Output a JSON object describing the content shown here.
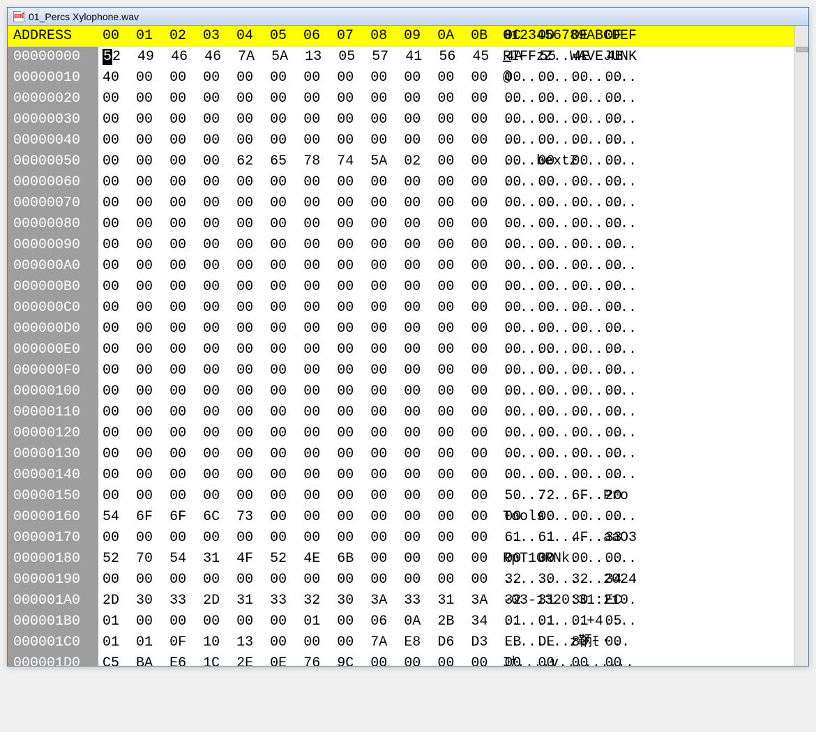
{
  "window": {
    "title": "01_Percs Xylophone.wav",
    "icon_label": "BIN"
  },
  "header": {
    "address_label": "ADDRESS",
    "hex_cols": [
      "00",
      "01",
      "02",
      "03",
      "04",
      "05",
      "06",
      "07",
      "08",
      "09",
      "0A",
      "0B",
      "0C",
      "0D",
      "0E",
      "0F"
    ],
    "ascii_label": "0123456789ABCDEF"
  },
  "cursor": {
    "row": 0,
    "col": 0
  },
  "rows": [
    {
      "addr": "00000000",
      "hex": [
        "52",
        "49",
        "46",
        "46",
        "7A",
        "5A",
        "13",
        "05",
        "57",
        "41",
        "56",
        "45",
        "4A",
        "55",
        "4E",
        "4B"
      ],
      "ascii": "RIFFzZ..WAVEJUNK"
    },
    {
      "addr": "00000010",
      "hex": [
        "40",
        "00",
        "00",
        "00",
        "00",
        "00",
        "00",
        "00",
        "00",
        "00",
        "00",
        "00",
        "00",
        "00",
        "00",
        "00"
      ],
      "ascii": "@..............."
    },
    {
      "addr": "00000020",
      "hex": [
        "00",
        "00",
        "00",
        "00",
        "00",
        "00",
        "00",
        "00",
        "00",
        "00",
        "00",
        "00",
        "00",
        "00",
        "00",
        "00"
      ],
      "ascii": "................"
    },
    {
      "addr": "00000030",
      "hex": [
        "00",
        "00",
        "00",
        "00",
        "00",
        "00",
        "00",
        "00",
        "00",
        "00",
        "00",
        "00",
        "00",
        "00",
        "00",
        "00"
      ],
      "ascii": "................"
    },
    {
      "addr": "00000040",
      "hex": [
        "00",
        "00",
        "00",
        "00",
        "00",
        "00",
        "00",
        "00",
        "00",
        "00",
        "00",
        "00",
        "00",
        "00",
        "00",
        "00"
      ],
      "ascii": "................"
    },
    {
      "addr": "00000050",
      "hex": [
        "00",
        "00",
        "00",
        "00",
        "62",
        "65",
        "78",
        "74",
        "5A",
        "02",
        "00",
        "00",
        "00",
        "00",
        "00",
        "00"
      ],
      "ascii": "....bextZ......."
    },
    {
      "addr": "00000060",
      "hex": [
        "00",
        "00",
        "00",
        "00",
        "00",
        "00",
        "00",
        "00",
        "00",
        "00",
        "00",
        "00",
        "00",
        "00",
        "00",
        "00"
      ],
      "ascii": "................"
    },
    {
      "addr": "00000070",
      "hex": [
        "00",
        "00",
        "00",
        "00",
        "00",
        "00",
        "00",
        "00",
        "00",
        "00",
        "00",
        "00",
        "00",
        "00",
        "00",
        "00"
      ],
      "ascii": "................"
    },
    {
      "addr": "00000080",
      "hex": [
        "00",
        "00",
        "00",
        "00",
        "00",
        "00",
        "00",
        "00",
        "00",
        "00",
        "00",
        "00",
        "00",
        "00",
        "00",
        "00"
      ],
      "ascii": "................"
    },
    {
      "addr": "00000090",
      "hex": [
        "00",
        "00",
        "00",
        "00",
        "00",
        "00",
        "00",
        "00",
        "00",
        "00",
        "00",
        "00",
        "00",
        "00",
        "00",
        "00"
      ],
      "ascii": "................"
    },
    {
      "addr": "000000A0",
      "hex": [
        "00",
        "00",
        "00",
        "00",
        "00",
        "00",
        "00",
        "00",
        "00",
        "00",
        "00",
        "00",
        "00",
        "00",
        "00",
        "00"
      ],
      "ascii": "................"
    },
    {
      "addr": "000000B0",
      "hex": [
        "00",
        "00",
        "00",
        "00",
        "00",
        "00",
        "00",
        "00",
        "00",
        "00",
        "00",
        "00",
        "00",
        "00",
        "00",
        "00"
      ],
      "ascii": "................"
    },
    {
      "addr": "000000C0",
      "hex": [
        "00",
        "00",
        "00",
        "00",
        "00",
        "00",
        "00",
        "00",
        "00",
        "00",
        "00",
        "00",
        "00",
        "00",
        "00",
        "00"
      ],
      "ascii": "................"
    },
    {
      "addr": "000000D0",
      "hex": [
        "00",
        "00",
        "00",
        "00",
        "00",
        "00",
        "00",
        "00",
        "00",
        "00",
        "00",
        "00",
        "00",
        "00",
        "00",
        "00"
      ],
      "ascii": "................"
    },
    {
      "addr": "000000E0",
      "hex": [
        "00",
        "00",
        "00",
        "00",
        "00",
        "00",
        "00",
        "00",
        "00",
        "00",
        "00",
        "00",
        "00",
        "00",
        "00",
        "00"
      ],
      "ascii": "................"
    },
    {
      "addr": "000000F0",
      "hex": [
        "00",
        "00",
        "00",
        "00",
        "00",
        "00",
        "00",
        "00",
        "00",
        "00",
        "00",
        "00",
        "00",
        "00",
        "00",
        "00"
      ],
      "ascii": "................"
    },
    {
      "addr": "00000100",
      "hex": [
        "00",
        "00",
        "00",
        "00",
        "00",
        "00",
        "00",
        "00",
        "00",
        "00",
        "00",
        "00",
        "00",
        "00",
        "00",
        "00"
      ],
      "ascii": "................"
    },
    {
      "addr": "00000110",
      "hex": [
        "00",
        "00",
        "00",
        "00",
        "00",
        "00",
        "00",
        "00",
        "00",
        "00",
        "00",
        "00",
        "00",
        "00",
        "00",
        "00"
      ],
      "ascii": "................"
    },
    {
      "addr": "00000120",
      "hex": [
        "00",
        "00",
        "00",
        "00",
        "00",
        "00",
        "00",
        "00",
        "00",
        "00",
        "00",
        "00",
        "00",
        "00",
        "00",
        "00"
      ],
      "ascii": "................"
    },
    {
      "addr": "00000130",
      "hex": [
        "00",
        "00",
        "00",
        "00",
        "00",
        "00",
        "00",
        "00",
        "00",
        "00",
        "00",
        "00",
        "00",
        "00",
        "00",
        "00"
      ],
      "ascii": "................"
    },
    {
      "addr": "00000140",
      "hex": [
        "00",
        "00",
        "00",
        "00",
        "00",
        "00",
        "00",
        "00",
        "00",
        "00",
        "00",
        "00",
        "00",
        "00",
        "00",
        "00"
      ],
      "ascii": "................"
    },
    {
      "addr": "00000150",
      "hex": [
        "00",
        "00",
        "00",
        "00",
        "00",
        "00",
        "00",
        "00",
        "00",
        "00",
        "00",
        "00",
        "50",
        "72",
        "6F",
        "20"
      ],
      "ascii": "............Pro "
    },
    {
      "addr": "00000160",
      "hex": [
        "54",
        "6F",
        "6F",
        "6C",
        "73",
        "00",
        "00",
        "00",
        "00",
        "00",
        "00",
        "00",
        "00",
        "00",
        "00",
        "00"
      ],
      "ascii": "Tools..........."
    },
    {
      "addr": "00000170",
      "hex": [
        "00",
        "00",
        "00",
        "00",
        "00",
        "00",
        "00",
        "00",
        "00",
        "00",
        "00",
        "00",
        "61",
        "61",
        "4F",
        "33"
      ],
      "ascii": "............aaO3"
    },
    {
      "addr": "00000180",
      "hex": [
        "52",
        "70",
        "54",
        "31",
        "4F",
        "52",
        "4E",
        "6B",
        "00",
        "00",
        "00",
        "00",
        "00",
        "00",
        "00",
        "00"
      ],
      "ascii": "RpT1ORNk........"
    },
    {
      "addr": "00000190",
      "hex": [
        "00",
        "00",
        "00",
        "00",
        "00",
        "00",
        "00",
        "00",
        "00",
        "00",
        "00",
        "00",
        "32",
        "30",
        "32",
        "34"
      ],
      "ascii": "............2024"
    },
    {
      "addr": "000001A0",
      "hex": [
        "2D",
        "30",
        "33",
        "2D",
        "31",
        "33",
        "32",
        "30",
        "3A",
        "33",
        "31",
        "3A",
        "32",
        "31",
        "30",
        "EC"
      ],
      "ascii": "-03-1320:31:210."
    },
    {
      "addr": "000001B0",
      "hex": [
        "01",
        "00",
        "00",
        "00",
        "00",
        "00",
        "01",
        "00",
        "06",
        "0A",
        "2B",
        "34",
        "01",
        "01",
        "01",
        "05"
      ],
      "ascii": "..........+4...."
    },
    {
      "addr": "000001C0",
      "hex": [
        "01",
        "01",
        "0F",
        "10",
        "13",
        "00",
        "00",
        "00",
        "7A",
        "E8",
        "D6",
        "D3",
        "EB",
        "DE",
        "80",
        "00"
      ],
      "ascii": "........z鞆ﾓ・.."
    },
    {
      "addr": "000001D0",
      "hex": [
        "C5",
        "BA",
        "E6",
        "1C",
        "2E",
        "0E",
        "76",
        "9C",
        "00",
        "00",
        "00",
        "00",
        "00",
        "00",
        "00",
        "00"
      ],
      "ascii": "ｺﾅ....v........."
    }
  ]
}
